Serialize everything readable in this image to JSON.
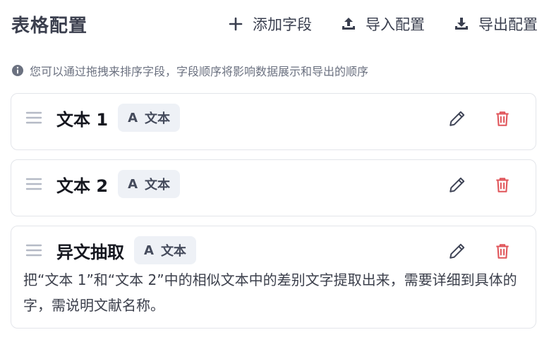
{
  "header": {
    "title": "表格配置",
    "add_label": "添加字段",
    "import_label": "导入配置",
    "export_label": "导出配置"
  },
  "hint": "您可以通过拖拽来排序字段，字段顺序将影响数据展示和导出的顺序",
  "fields": [
    {
      "name": "文本 1",
      "type_label": "文本",
      "type_icon": "A",
      "description": ""
    },
    {
      "name": "文本 2",
      "type_label": "文本",
      "type_icon": "A",
      "description": ""
    },
    {
      "name": "异文抽取",
      "type_label": "文本",
      "type_icon": "A",
      "description": "把“文本 1”和“文本 2”中的相似文本中的差别文字提取出来，需要详细到具体的字，需说明文献名称。"
    }
  ],
  "colors": {
    "accent_text": "#3b3f4e",
    "danger": "#e0555a",
    "tag_bg": "#eef1f6",
    "border": "#e3e5ea"
  }
}
